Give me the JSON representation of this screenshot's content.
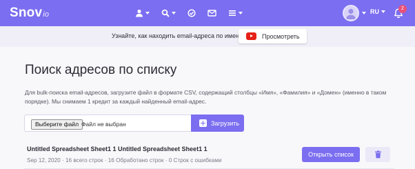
{
  "app": {
    "logo_main": "Snov",
    "logo_suffix": "io"
  },
  "header": {
    "nav_items": [
      {
        "icon": "user-icon",
        "has_dropdown": true
      },
      {
        "icon": "search-icon",
        "has_dropdown": true
      },
      {
        "icon": "check-circle-icon",
        "has_dropdown": false
      },
      {
        "icon": "mail-icon",
        "has_dropdown": false
      },
      {
        "icon": "menu-icon",
        "has_dropdown": true
      }
    ],
    "language": "RU",
    "notifications_count": "2"
  },
  "infobar": {
    "text": "Узнайте, как находить email-адреса по имени",
    "button_label": "Просмотреть"
  },
  "main": {
    "title": "Поиск адресов по списку",
    "description": "Для bulk-поиска email-адресов, загрузите файл в формате CSV, содержащий столбцы «Имя», «Фамилия» и «Домен» (именно в таком порядке). Мы снимаем 1 кредит за каждый найденный email-адрес.",
    "file_button_label": "Выберите файл",
    "file_status": "Файл не выбран",
    "upload_button_label": "Загрузить"
  },
  "files": [
    {
      "name": "Untitled Spreadsheet Sheet1 1 Untitled Spreadsheet Sheet1 1",
      "meta": "Sep 12, 2020 · 16 всего строк · 16 Обработано строк · 0 Строк с ошибками",
      "open_label": "Открыть список"
    }
  ],
  "colors": {
    "accent": "#7b6ef0",
    "badge": "#e8517a",
    "youtube": "#e62117"
  }
}
